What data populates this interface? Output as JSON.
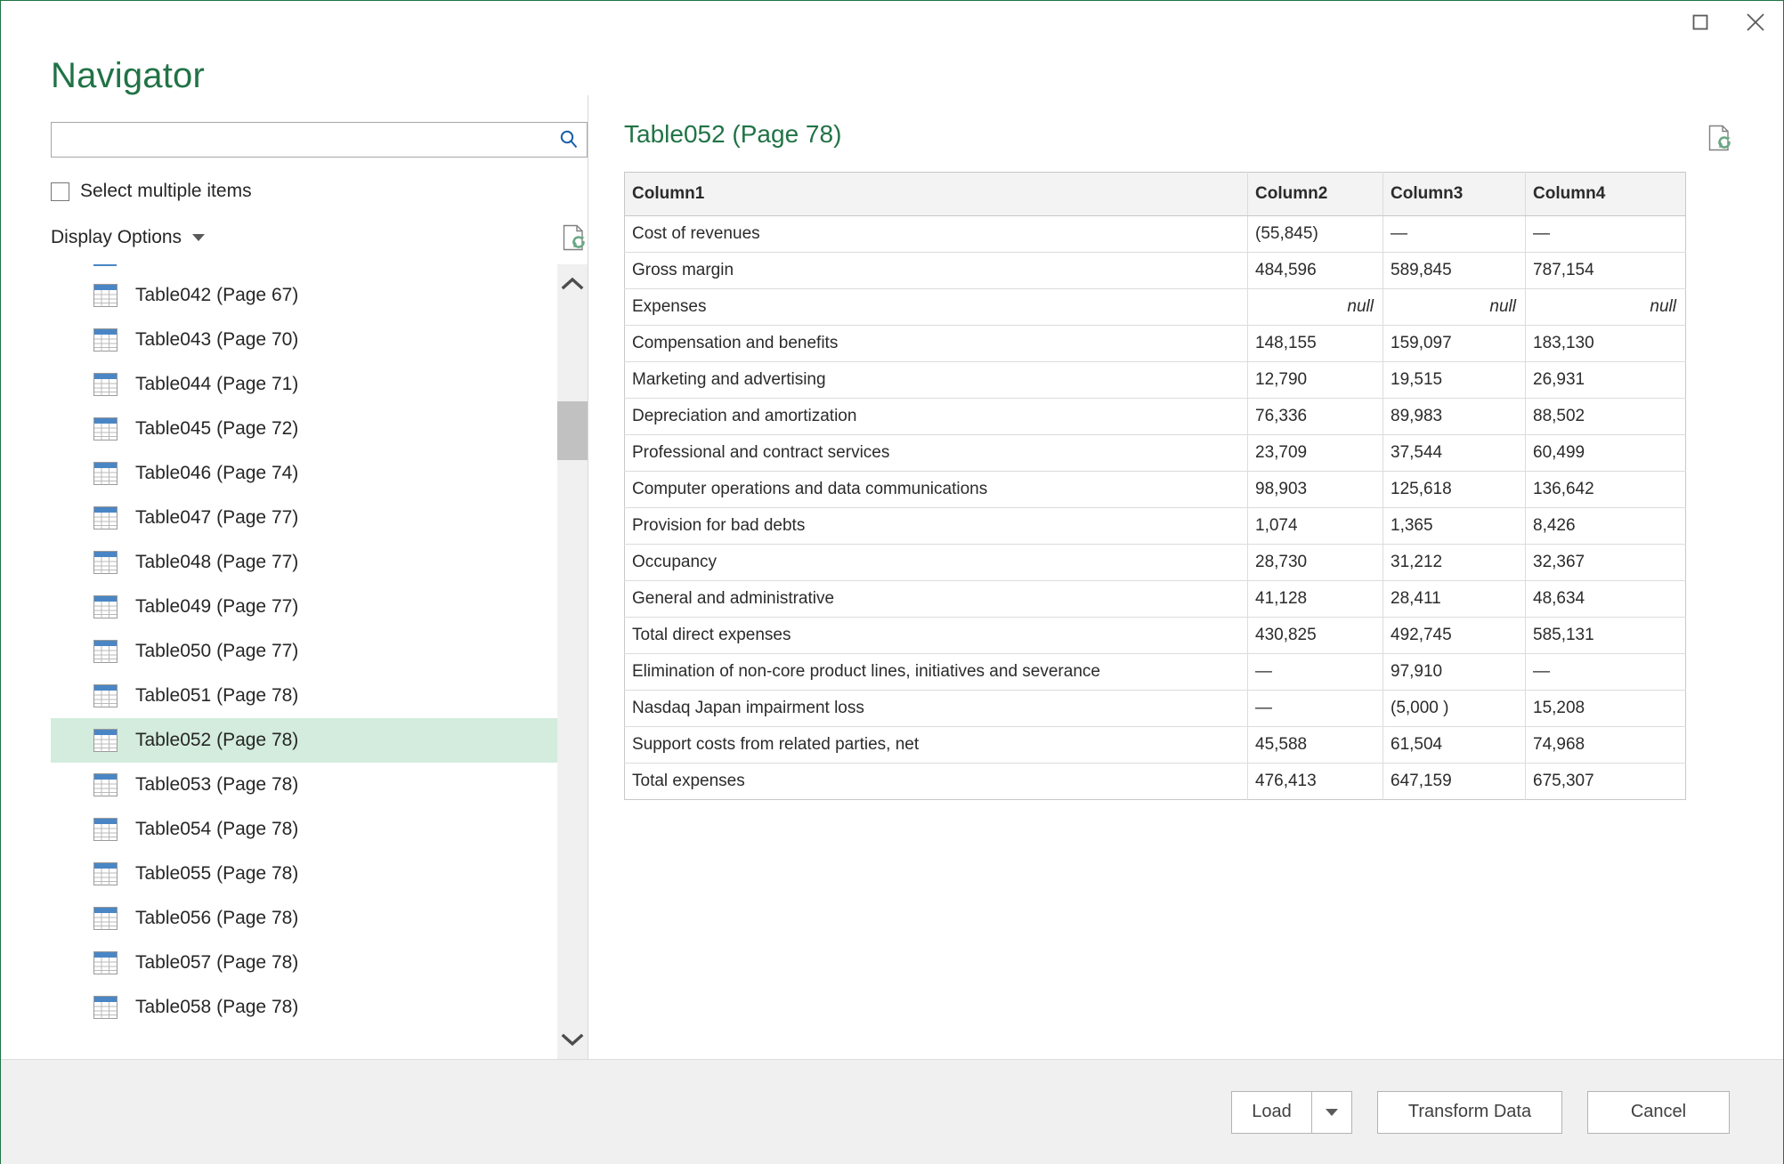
{
  "window": {
    "accent_green": "#217346",
    "restore_label": "Restore",
    "close_label": "Close"
  },
  "header": {
    "title": "Navigator"
  },
  "search": {
    "value": "",
    "placeholder": ""
  },
  "options": {
    "select_multiple_label": "Select multiple items",
    "display_options_label": "Display Options",
    "refresh_label": "Refresh"
  },
  "tree": {
    "selected": "Table052 (Page 78)",
    "highlight_color": "#d3ecdd",
    "items": [
      {
        "label": "Table042 (Page 67)",
        "selected": false
      },
      {
        "label": "Table043 (Page 70)",
        "selected": false
      },
      {
        "label": "Table044 (Page 71)",
        "selected": false
      },
      {
        "label": "Table045 (Page 72)",
        "selected": false
      },
      {
        "label": "Table046 (Page 74)",
        "selected": false
      },
      {
        "label": "Table047 (Page 77)",
        "selected": false
      },
      {
        "label": "Table048 (Page 77)",
        "selected": false
      },
      {
        "label": "Table049 (Page 77)",
        "selected": false
      },
      {
        "label": "Table050 (Page 77)",
        "selected": false
      },
      {
        "label": "Table051 (Page 78)",
        "selected": false
      },
      {
        "label": "Table052 (Page 78)",
        "selected": true
      },
      {
        "label": "Table053 (Page 78)",
        "selected": false
      },
      {
        "label": "Table054 (Page 78)",
        "selected": false
      },
      {
        "label": "Table055 (Page 78)",
        "selected": false
      },
      {
        "label": "Table056 (Page 78)",
        "selected": false
      },
      {
        "label": "Table057 (Page 78)",
        "selected": false
      },
      {
        "label": "Table058 (Page 78)",
        "selected": false
      }
    ]
  },
  "preview": {
    "title": "Table052 (Page 78)",
    "refresh_label": "Refresh preview",
    "columns": [
      "Column1",
      "Column2",
      "Column3",
      "Column4"
    ],
    "rows": [
      [
        "Cost of revenues",
        "(55,845)",
        "—",
        "—"
      ],
      [
        "Gross margin",
        "484,596",
        "589,845",
        "787,154"
      ],
      [
        "Expenses",
        "null",
        "null",
        "null"
      ],
      [
        "Compensation and benefits",
        "148,155",
        "159,097",
        "183,130"
      ],
      [
        "Marketing and advertising",
        "12,790",
        "19,515",
        "26,931"
      ],
      [
        "Depreciation and amortization",
        "76,336",
        "89,983",
        "88,502"
      ],
      [
        "Professional and contract services",
        "23,709",
        "37,544",
        "60,499"
      ],
      [
        "Computer operations and data communications",
        "98,903",
        "125,618",
        "136,642"
      ],
      [
        "Provision for bad debts",
        "1,074",
        "1,365",
        "8,426"
      ],
      [
        "Occupancy",
        "28,730",
        "31,212",
        "32,367"
      ],
      [
        "General and administrative",
        "41,128",
        "28,411",
        "48,634"
      ],
      [
        "Total direct expenses",
        "430,825",
        "492,745",
        "585,131"
      ],
      [
        "Elimination of non-core product lines, initiatives and severance",
        "—",
        "97,910",
        "—"
      ],
      [
        "Nasdaq Japan impairment loss",
        "—",
        "(5,000 )",
        "15,208"
      ],
      [
        "Support costs from related parties, net",
        "45,588",
        "61,504",
        "74,968"
      ],
      [
        "Total expenses",
        "476,413",
        "647,159",
        "675,307"
      ]
    ]
  },
  "footer": {
    "load_label": "Load",
    "load_more_label": "Load options",
    "transform_label": "Transform Data",
    "cancel_label": "Cancel"
  }
}
